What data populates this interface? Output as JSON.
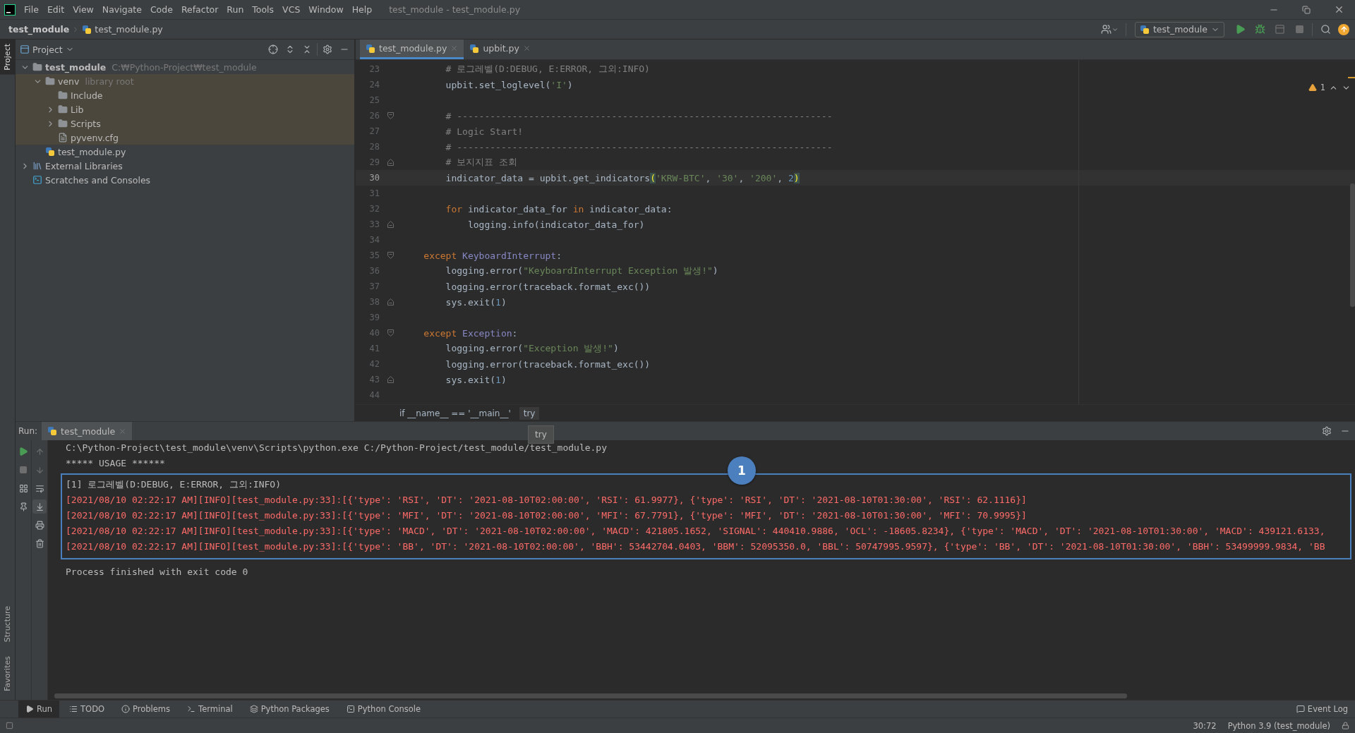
{
  "window": {
    "title": "test_module - test_module.py"
  },
  "menu": [
    "File",
    "Edit",
    "View",
    "Navigate",
    "Code",
    "Refactor",
    "Run",
    "Tools",
    "VCS",
    "Window",
    "Help"
  ],
  "breadcrumb": {
    "project": "test_module",
    "file": "test_module.py"
  },
  "run_configuration": {
    "name": "test_module"
  },
  "side_stripe": {
    "top": [
      {
        "label": "Project",
        "selected": true
      }
    ],
    "bottom": [
      {
        "label": "Structure",
        "selected": false
      },
      {
        "label": "Favorites",
        "selected": false
      }
    ]
  },
  "project_panel": {
    "title": "Project",
    "tree": [
      {
        "label": "test_module",
        "hint": "C:₩Python-Project₩test_module",
        "kind": "project",
        "expanded": true,
        "children": [
          {
            "label": "venv",
            "hint": "library root",
            "kind": "folder",
            "expanded": true,
            "library_root": true,
            "children": [
              {
                "label": "Include",
                "kind": "folder"
              },
              {
                "label": "Lib",
                "kind": "folder",
                "expanded": false
              },
              {
                "label": "Scripts",
                "kind": "folder",
                "expanded": false
              },
              {
                "label": "pyvenv.cfg",
                "kind": "file"
              }
            ]
          },
          {
            "label": "test_module.py",
            "kind": "python"
          }
        ]
      },
      {
        "label": "External Libraries",
        "kind": "libraries",
        "expanded": false
      },
      {
        "label": "Scratches and Consoles",
        "kind": "scratches"
      }
    ]
  },
  "editor": {
    "tabs": [
      {
        "label": "test_module.py",
        "selected": true
      },
      {
        "label": "upbit.py",
        "selected": false
      }
    ],
    "warnings": "1",
    "lines": [
      {
        "number": "23",
        "current": false,
        "tokens": [
          {
            "kind": "comment",
            "text": "        # 로그레벨(D:DEBUG, E:ERROR, 그외:INFO)"
          }
        ]
      },
      {
        "number": "24",
        "current": false,
        "tokens": [
          {
            "kind": "plain",
            "text": "        upbit.set_loglevel("
          },
          {
            "kind": "string",
            "text": "'I'"
          },
          {
            "kind": "plain",
            "text": ")"
          }
        ]
      },
      {
        "number": "25",
        "current": false
      },
      {
        "number": "26",
        "current": false,
        "fold_start": true,
        "tokens": [
          {
            "kind": "comment",
            "text": "        # --------------------------------------------------------------------"
          }
        ]
      },
      {
        "number": "27",
        "current": false,
        "tokens": [
          {
            "kind": "comment",
            "text": "        # Logic Start!"
          }
        ]
      },
      {
        "number": "28",
        "current": false,
        "tokens": [
          {
            "kind": "comment",
            "text": "        # --------------------------------------------------------------------"
          }
        ]
      },
      {
        "number": "29",
        "current": false,
        "fold_end": true,
        "tokens": [
          {
            "kind": "comment",
            "text": "        # 보지지표 조회"
          }
        ]
      },
      {
        "number": "30",
        "current": true,
        "tokens": [
          {
            "kind": "plain",
            "text": "        indicator_data = upbit.get_indicators"
          },
          {
            "kind": "brace",
            "text": "("
          },
          {
            "kind": "string",
            "text": "'KRW-BTC'"
          },
          {
            "kind": "plain",
            "text": ", "
          },
          {
            "kind": "string",
            "text": "'30'"
          },
          {
            "kind": "plain",
            "text": ", "
          },
          {
            "kind": "string",
            "text": "'200'"
          },
          {
            "kind": "plain",
            "text": ", "
          },
          {
            "kind": "number",
            "text": "2"
          },
          {
            "kind": "brace",
            "text": ")"
          }
        ]
      },
      {
        "number": "31",
        "current": false
      },
      {
        "number": "32",
        "current": false,
        "tokens": [
          {
            "kind": "keyword",
            "text": "        for"
          },
          {
            "kind": "plain",
            "text": " indicator_data_for "
          },
          {
            "kind": "keyword",
            "text": "in"
          },
          {
            "kind": "plain",
            "text": " indicator_data:"
          }
        ]
      },
      {
        "number": "33",
        "current": false,
        "fold_end": true,
        "tokens": [
          {
            "kind": "plain",
            "text": "            logging.info(indicator_data_for)"
          }
        ]
      },
      {
        "number": "34",
        "current": false
      },
      {
        "number": "35",
        "current": false,
        "fold_start": true,
        "tokens": [
          {
            "kind": "keyword",
            "text": "    except"
          },
          {
            "kind": "builtin",
            "text": " KeyboardInterrupt"
          },
          {
            "kind": "plain",
            "text": ":"
          }
        ]
      },
      {
        "number": "36",
        "current": false,
        "tokens": [
          {
            "kind": "plain",
            "text": "        logging.error("
          },
          {
            "kind": "string",
            "text": "\"KeyboardInterrupt Exception 발생!\""
          },
          {
            "kind": "plain",
            "text": ")"
          }
        ]
      },
      {
        "number": "37",
        "current": false,
        "tokens": [
          {
            "kind": "plain",
            "text": "        logging.error(traceback.format_exc())"
          }
        ]
      },
      {
        "number": "38",
        "current": false,
        "fold_end": true,
        "tokens": [
          {
            "kind": "plain",
            "text": "        sys.exit("
          },
          {
            "kind": "number",
            "text": "1"
          },
          {
            "kind": "plain",
            "text": ")"
          }
        ]
      },
      {
        "number": "39",
        "current": false
      },
      {
        "number": "40",
        "current": false,
        "fold_start": true,
        "tokens": [
          {
            "kind": "keyword",
            "text": "    except"
          },
          {
            "kind": "builtin",
            "text": " Exception"
          },
          {
            "kind": "plain",
            "text": ":"
          }
        ]
      },
      {
        "number": "41",
        "current": false,
        "tokens": [
          {
            "kind": "plain",
            "text": "        logging.error("
          },
          {
            "kind": "string",
            "text": "\"Exception 발생!\""
          },
          {
            "kind": "plain",
            "text": ")"
          }
        ]
      },
      {
        "number": "42",
        "current": false,
        "tokens": [
          {
            "kind": "plain",
            "text": "        logging.error(traceback.format_exc())"
          }
        ]
      },
      {
        "number": "43",
        "current": false,
        "fold_end": true,
        "tokens": [
          {
            "kind": "plain",
            "text": "        sys.exit("
          },
          {
            "kind": "number",
            "text": "1"
          },
          {
            "kind": "plain",
            "text": ")"
          }
        ]
      },
      {
        "number": "44",
        "current": false
      }
    ],
    "code_breadcrumb": [
      "if __name__ == '__main__'",
      "try"
    ],
    "tooltip": "try"
  },
  "run_panel": {
    "label": "Run:",
    "tabs": [
      {
        "label": "test_module",
        "selected": true
      }
    ],
    "console": [
      {
        "kind": "command",
        "text": "C:\\Python-Project\\test_module\\venv\\Scripts\\python.exe C:/Python-Project/test_module/test_module.py"
      },
      {
        "kind": "output",
        "text": "***** USAGE ******"
      },
      {
        "kind": "output",
        "text": "[1] 로그레벨(D:DEBUG, E:ERROR, 그외:INFO)"
      },
      {
        "kind": "error",
        "text": "[2021/08/10 02:22:17 AM][INFO][test_module.py:33]:[{'type': 'RSI', 'DT': '2021-08-10T02:00:00', 'RSI': 61.9977}, {'type': 'RSI', 'DT': '2021-08-10T01:30:00', 'RSI': 62.1116}]"
      },
      {
        "kind": "error",
        "text": "[2021/08/10 02:22:17 AM][INFO][test_module.py:33]:[{'type': 'MFI', 'DT': '2021-08-10T02:00:00', 'MFI': 67.7791}, {'type': 'MFI', 'DT': '2021-08-10T01:30:00', 'MFI': 70.9995}]"
      },
      {
        "kind": "error",
        "text": "[2021/08/10 02:22:17 AM][INFO][test_module.py:33]:[{'type': 'MACD', 'DT': '2021-08-10T02:00:00', 'MACD': 421805.1652, 'SIGNAL': 440410.9886, 'OCL': -18605.8234}, {'type': 'MACD', 'DT': '2021-08-10T01:30:00', 'MACD': 439121.6133,"
      },
      {
        "kind": "error",
        "text": "[2021/08/10 02:22:17 AM][INFO][test_module.py:33]:[{'type': 'BB', 'DT': '2021-08-10T02:00:00', 'BBH': 53442704.0403, 'BBM': 52095350.0, 'BBL': 50747995.9597}, {'type': 'BB', 'DT': '2021-08-10T01:30:00', 'BBH': 53499999.9834, 'BB"
      },
      {
        "kind": "exit",
        "text": "Process finished with exit code 0"
      }
    ],
    "highlight": {
      "badge": "1"
    }
  },
  "tool_windows": [
    {
      "label": "Run",
      "kind": "run",
      "selected": true
    },
    {
      "label": "TODO",
      "kind": "todo",
      "selected": false
    },
    {
      "label": "Problems",
      "kind": "problems",
      "selected": false
    },
    {
      "label": "Terminal",
      "kind": "terminal",
      "selected": false
    },
    {
      "label": "Python Packages",
      "kind": "packages",
      "selected": false
    },
    {
      "label": "Python Console",
      "kind": "console",
      "selected": false
    }
  ],
  "event_log": "Event Log",
  "status_bar": {
    "position": "30:72",
    "interpreter": "Python 3.9 (test_module)"
  }
}
